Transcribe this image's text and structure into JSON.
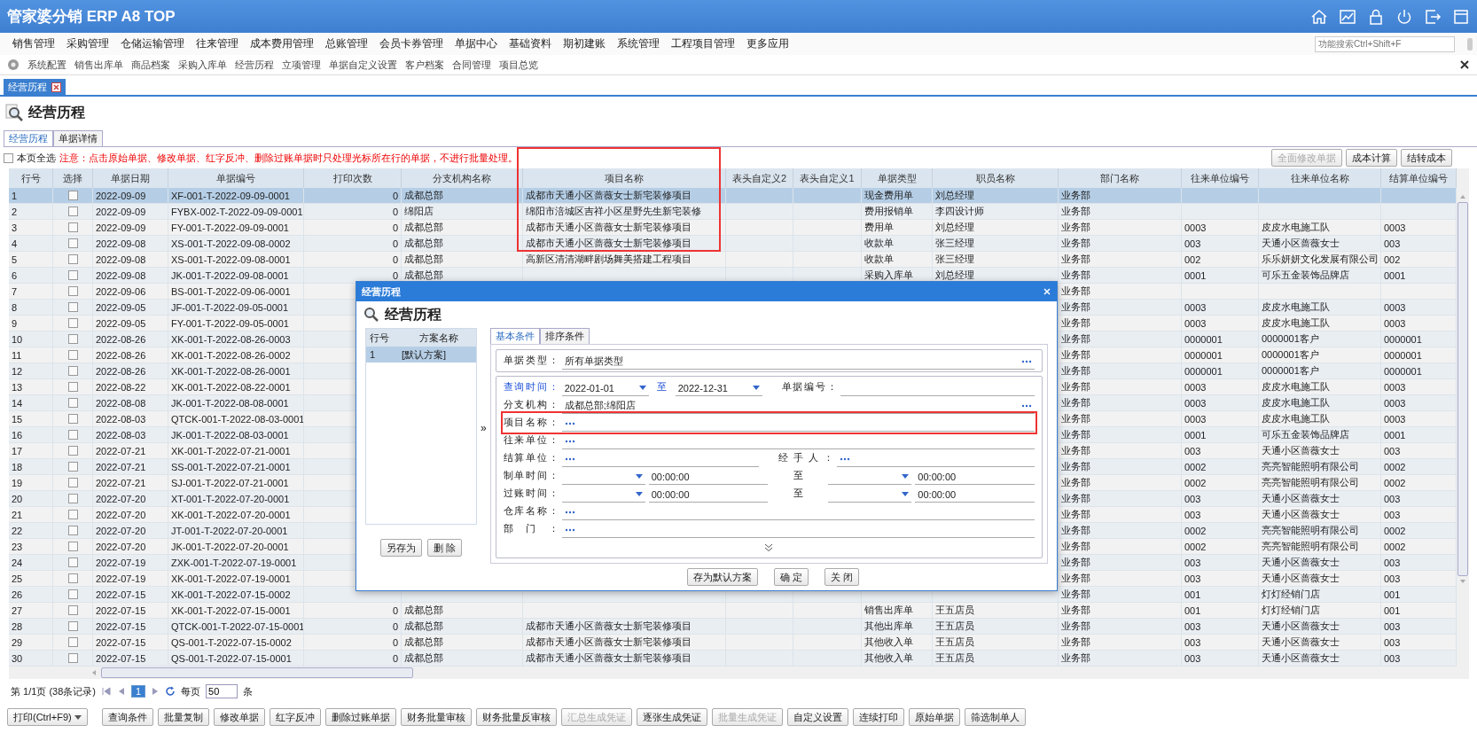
{
  "app_bar": {
    "title": "管家婆分销 ERP A8 TOP"
  },
  "menu": {
    "items": [
      "销售管理",
      "采购管理",
      "仓储运输管理",
      "往来管理",
      "成本费用管理",
      "总账管理",
      "会员卡券管理",
      "单据中心",
      "基础资料",
      "期初建账",
      "系统管理",
      "工程项目管理",
      "更多应用"
    ],
    "search": {
      "placeholder": "功能搜索Ctrl+Shift+F"
    }
  },
  "quick_links": [
    "系统配置",
    "销售出库单",
    "商品档案",
    "采购入库单",
    "经营历程",
    "立项管理",
    "单据自定义设置",
    "客户档案",
    "合同管理",
    "项目总览"
  ],
  "open_tabs": [
    {
      "label": "经营历程",
      "selected": true
    }
  ],
  "page": {
    "heading": "经营历程",
    "tabs": [
      {
        "label": "经营历程",
        "selected": true
      },
      {
        "label": "单据详情",
        "selected": false
      }
    ],
    "select_all": {
      "label": "本页全选",
      "checked": false
    },
    "notice": "注意：点击原始单据、修改单据、红字反冲、删除过账单据时只处理光标所在行的单据，不进行批量处理。",
    "actions": [
      {
        "label": "全面修改单据",
        "disabled": true
      },
      {
        "label": "成本计算",
        "disabled": false
      },
      {
        "label": "结转成本",
        "disabled": false
      }
    ]
  },
  "table": {
    "columns": [
      "行号",
      "选择",
      "单据日期",
      "单据编号",
      "打印次数",
      "分支机构名称",
      "项目名称",
      "表头自定义2",
      "表头自定义1",
      "单据类型",
      "职员名称",
      "部门名称",
      "往来单位编号",
      "往来单位名称",
      "结算单位编号"
    ],
    "rows": [
      {
        "no": "1",
        "selected": true,
        "checked": false,
        "date": "2022-09-09",
        "code": "XF-001-T-2022-09-09-0001",
        "prints": "0",
        "branch": "成都总部",
        "project": "成都市天通小区蔷薇女士新宅装修项目",
        "type": "现金费用单",
        "staff": "刘总经理",
        "dept": "业务部"
      },
      {
        "no": "2",
        "selected": false,
        "checked": false,
        "date": "2022-09-09",
        "code": "FYBX-002-T-2022-09-09-0001",
        "prints": "0",
        "branch": "绵阳店",
        "project": "绵阳市涪城区吉祥小区星野先生新宅装修",
        "type": "费用报销单",
        "staff": "李四设计师",
        "dept": "业务部"
      },
      {
        "no": "3",
        "selected": false,
        "checked": false,
        "date": "2022-09-09",
        "code": "FY-001-T-2022-09-09-0001",
        "prints": "0",
        "branch": "成都总部",
        "project": "成都市天通小区蔷薇女士新宅装修项目",
        "type": "费用单",
        "staff": "刘总经理",
        "dept": "业务部",
        "partner_code": "0003",
        "partner": "皮皮水电施工队",
        "settle_code": "0003"
      },
      {
        "no": "4",
        "selected": false,
        "checked": false,
        "date": "2022-09-08",
        "code": "XS-001-T-2022-09-08-0002",
        "prints": "0",
        "branch": "成都总部",
        "project": "成都市天通小区蔷薇女士新宅装修项目",
        "type": "收款单",
        "staff": "张三经理",
        "dept": "业务部",
        "partner_code": "003",
        "partner": "天通小区蔷薇女士",
        "settle_code": "003"
      },
      {
        "no": "5",
        "selected": false,
        "checked": false,
        "date": "2022-09-08",
        "code": "XS-001-T-2022-09-08-0001",
        "prints": "0",
        "branch": "成都总部",
        "project": "高新区清清湖畔剧场舞美搭建工程项目",
        "type": "收款单",
        "staff": "张三经理",
        "dept": "业务部",
        "partner_code": "002",
        "partner": "乐乐妍妍文化发展有限公司",
        "settle_code": "002"
      },
      {
        "no": "6",
        "selected": false,
        "checked": false,
        "date": "2022-09-08",
        "code": "JK-001-T-2022-09-08-0001",
        "prints": "0",
        "branch": "成都总部",
        "type": "采购入库单",
        "staff": "刘总经理",
        "dept": "业务部",
        "partner_code": "0001",
        "partner": "可乐五金装饰品牌店",
        "settle_code": "0001"
      },
      {
        "no": "7",
        "selected": false,
        "checked": false,
        "date": "2022-09-06",
        "code": "BS-001-T-2022-09-06-0001",
        "dept": "业务部"
      },
      {
        "no": "8",
        "selected": false,
        "checked": false,
        "date": "2022-09-05",
        "code": "JF-001-T-2022-09-05-0001",
        "dept": "业务部",
        "partner_code": "0003",
        "partner": "皮皮水电施工队",
        "settle_code": "0003"
      },
      {
        "no": "9",
        "selected": false,
        "checked": false,
        "date": "2022-09-05",
        "code": "FY-001-T-2022-09-05-0001",
        "dept": "业务部",
        "partner_code": "0003",
        "partner": "皮皮水电施工队",
        "settle_code": "0003"
      },
      {
        "no": "10",
        "selected": false,
        "checked": false,
        "date": "2022-08-26",
        "code": "XK-001-T-2022-08-26-0003",
        "dept": "业务部",
        "partner_code": "0000001",
        "partner": "0000001客户",
        "settle_code": "0000001"
      },
      {
        "no": "11",
        "selected": false,
        "checked": false,
        "date": "2022-08-26",
        "code": "XK-001-T-2022-08-26-0002",
        "dept": "业务部",
        "partner_code": "0000001",
        "partner": "0000001客户",
        "settle_code": "0000001"
      },
      {
        "no": "12",
        "selected": false,
        "checked": false,
        "date": "2022-08-26",
        "code": "XK-001-T-2022-08-26-0001",
        "dept": "业务部",
        "partner_code": "0000001",
        "partner": "0000001客户",
        "settle_code": "0000001"
      },
      {
        "no": "13",
        "selected": false,
        "checked": false,
        "date": "2022-08-22",
        "code": "XK-001-T-2022-08-22-0001",
        "dept": "业务部",
        "partner_code": "0003",
        "partner": "皮皮水电施工队",
        "settle_code": "0003"
      },
      {
        "no": "14",
        "selected": false,
        "checked": false,
        "date": "2022-08-08",
        "code": "JK-001-T-2022-08-08-0001",
        "dept": "业务部",
        "partner_code": "0003",
        "partner": "皮皮水电施工队",
        "settle_code": "0003"
      },
      {
        "no": "15",
        "selected": false,
        "checked": false,
        "date": "2022-08-03",
        "code": "QTCK-001-T-2022-08-03-0001",
        "dept": "业务部",
        "partner_code": "0003",
        "partner": "皮皮水电施工队",
        "settle_code": "0003"
      },
      {
        "no": "16",
        "selected": false,
        "checked": false,
        "date": "2022-08-03",
        "code": "JK-001-T-2022-08-03-0001",
        "dept": "业务部",
        "partner_code": "0001",
        "partner": "可乐五金装饰品牌店",
        "settle_code": "0001"
      },
      {
        "no": "17",
        "selected": false,
        "checked": false,
        "date": "2022-07-21",
        "code": "XK-001-T-2022-07-21-0001",
        "dept": "业务部",
        "partner_code": "003",
        "partner": "天通小区蔷薇女士",
        "settle_code": "003"
      },
      {
        "no": "18",
        "selected": false,
        "checked": false,
        "date": "2022-07-21",
        "code": "SS-001-T-2022-07-21-0001",
        "dept": "业务部",
        "partner_code": "0002",
        "partner": "亮亮智能照明有限公司",
        "settle_code": "0002"
      },
      {
        "no": "19",
        "selected": false,
        "checked": false,
        "date": "2022-07-21",
        "code": "SJ-001-T-2022-07-21-0001",
        "dept": "业务部",
        "partner_code": "0002",
        "partner": "亮亮智能照明有限公司",
        "settle_code": "0002"
      },
      {
        "no": "20",
        "selected": false,
        "checked": false,
        "date": "2022-07-20",
        "code": "XT-001-T-2022-07-20-0001",
        "dept": "业务部",
        "partner_code": "003",
        "partner": "天通小区蔷薇女士",
        "settle_code": "003"
      },
      {
        "no": "21",
        "selected": false,
        "checked": false,
        "date": "2022-07-20",
        "code": "XK-001-T-2022-07-20-0001",
        "dept": "业务部",
        "partner_code": "003",
        "partner": "天通小区蔷薇女士",
        "settle_code": "003"
      },
      {
        "no": "22",
        "selected": false,
        "checked": false,
        "date": "2022-07-20",
        "code": "JT-001-T-2022-07-20-0001",
        "dept": "业务部",
        "partner_code": "0002",
        "partner": "亮亮智能照明有限公司",
        "settle_code": "0002"
      },
      {
        "no": "23",
        "selected": false,
        "checked": false,
        "date": "2022-07-20",
        "code": "JK-001-T-2022-07-20-0001",
        "dept": "业务部",
        "partner_code": "0002",
        "partner": "亮亮智能照明有限公司",
        "settle_code": "0002"
      },
      {
        "no": "24",
        "selected": false,
        "checked": false,
        "date": "2022-07-19",
        "code": "ZXK-001-T-2022-07-19-0001",
        "dept": "业务部",
        "partner_code": "003",
        "partner": "天通小区蔷薇女士",
        "settle_code": "003"
      },
      {
        "no": "25",
        "selected": false,
        "checked": false,
        "date": "2022-07-19",
        "code": "XK-001-T-2022-07-19-0001",
        "dept": "业务部",
        "partner_code": "003",
        "partner": "天通小区蔷薇女士",
        "settle_code": "003"
      },
      {
        "no": "26",
        "selected": false,
        "checked": false,
        "date": "2022-07-15",
        "code": "XK-001-T-2022-07-15-0002",
        "dept": "业务部",
        "partner_code": "001",
        "partner": "灯灯经销门店",
        "settle_code": "001"
      },
      {
        "no": "27",
        "selected": false,
        "checked": false,
        "date": "2022-07-15",
        "code": "XK-001-T-2022-07-15-0001",
        "prints": "0",
        "branch": "成都总部",
        "type": "销售出库单",
        "staff": "王五店员",
        "dept": "业务部",
        "partner_code": "001",
        "partner": "灯灯经销门店",
        "settle_code": "001"
      },
      {
        "no": "28",
        "selected": false,
        "checked": false,
        "date": "2022-07-15",
        "code": "QTCK-001-T-2022-07-15-0001",
        "prints": "0",
        "branch": "成都总部",
        "project": "成都市天通小区蔷薇女士新宅装修项目",
        "type": "其他出库单",
        "staff": "王五店员",
        "dept": "业务部",
        "partner_code": "003",
        "partner": "天通小区蔷薇女士",
        "settle_code": "003"
      },
      {
        "no": "29",
        "selected": false,
        "checked": false,
        "date": "2022-07-15",
        "code": "QS-001-T-2022-07-15-0002",
        "prints": "0",
        "branch": "成都总部",
        "project": "成都市天通小区蔷薇女士新宅装修项目",
        "type": "其他收入单",
        "staff": "王五店员",
        "dept": "业务部",
        "partner_code": "003",
        "partner": "天通小区蔷薇女士",
        "settle_code": "003"
      },
      {
        "no": "30",
        "selected": false,
        "checked": false,
        "date": "2022-07-15",
        "code": "QS-001-T-2022-07-15-0001",
        "prints": "0",
        "branch": "成都总部",
        "project": "成都市天通小区蔷薇女士新宅装修项目",
        "type": "其他收入单",
        "staff": "王五店员",
        "dept": "业务部",
        "partner_code": "003",
        "partner": "天通小区蔷薇女士",
        "settle_code": "003"
      }
    ]
  },
  "pagination": {
    "summary": "第 1/1页 (38条记录)",
    "pages": [
      {
        "label": "1",
        "selected": true
      }
    ],
    "per_page_label": "每页",
    "per_page": "50",
    "unit": "条"
  },
  "toolbar": [
    {
      "label": "打印(Ctrl+F9)",
      "kind": "dropdown",
      "disabled": false
    },
    {
      "label": "查询条件",
      "kind": "button",
      "disabled": false
    },
    {
      "label": "批量复制",
      "kind": "button",
      "disabled": false
    },
    {
      "label": "修改单据",
      "kind": "button",
      "disabled": false
    },
    {
      "label": "红字反冲",
      "kind": "button",
      "disabled": false
    },
    {
      "label": "删除过账单据",
      "kind": "button",
      "disabled": false
    },
    {
      "label": "财务批量审核",
      "kind": "button",
      "disabled": false
    },
    {
      "label": "财务批量反审核",
      "kind": "button",
      "disabled": false
    },
    {
      "label": "汇总生成凭证",
      "kind": "button",
      "disabled": true
    },
    {
      "label": "逐张生成凭证",
      "kind": "button",
      "disabled": false
    },
    {
      "label": "批量生成凭证",
      "kind": "button",
      "disabled": true
    },
    {
      "label": "自定义设置",
      "kind": "button",
      "disabled": false
    },
    {
      "label": "连续打印",
      "kind": "button",
      "disabled": false
    },
    {
      "label": "原始单据",
      "kind": "button",
      "disabled": false
    },
    {
      "label": "筛选制单人",
      "kind": "button",
      "disabled": false
    }
  ],
  "dialog": {
    "title": "经营历程",
    "heading": "经营历程",
    "schemes": {
      "columns": [
        "行号",
        "方案名称"
      ],
      "rows": [
        {
          "no": "1",
          "name": "[默认方案]",
          "selected": true
        }
      ]
    },
    "scheme_buttons": [
      "另存为",
      "删 除"
    ],
    "expand": "»",
    "tabs": [
      {
        "label": "基本条件",
        "selected": true
      },
      {
        "label": "排序条件",
        "selected": false
      }
    ],
    "fields": [
      {
        "kind": "lookup",
        "label": "单据类型：",
        "value": "所有单据类型",
        "boxed": true
      },
      {
        "kind": "date_range",
        "label": "查询时间：",
        "from": "2022-01-01",
        "to_label": "至",
        "to": "2022-12-31",
        "extra_label": "单据编号："
      },
      {
        "kind": "lookup",
        "label": "分支机构：",
        "value": "成都总部;绵阳店"
      },
      {
        "kind": "lookup",
        "label": "项目名称：",
        "highlighted": true
      },
      {
        "kind": "lookup",
        "label": "往来单位："
      },
      {
        "kind": "pair",
        "label": "结算单位：",
        "label2": "经手人："
      },
      {
        "kind": "time_range",
        "label": "制单时间：",
        "time": "00:00:00",
        "to_label": "至",
        "time2": "00:00:00"
      },
      {
        "kind": "time_range",
        "label": "过账时间：",
        "time": "00:00:00",
        "to_label": "至",
        "time2": "00:00:00"
      },
      {
        "kind": "lookup",
        "label": "仓库名称："
      },
      {
        "kind": "lookup",
        "label": "部门："
      }
    ],
    "buttons": [
      "存为默认方案",
      "确 定",
      "关 闭"
    ]
  }
}
